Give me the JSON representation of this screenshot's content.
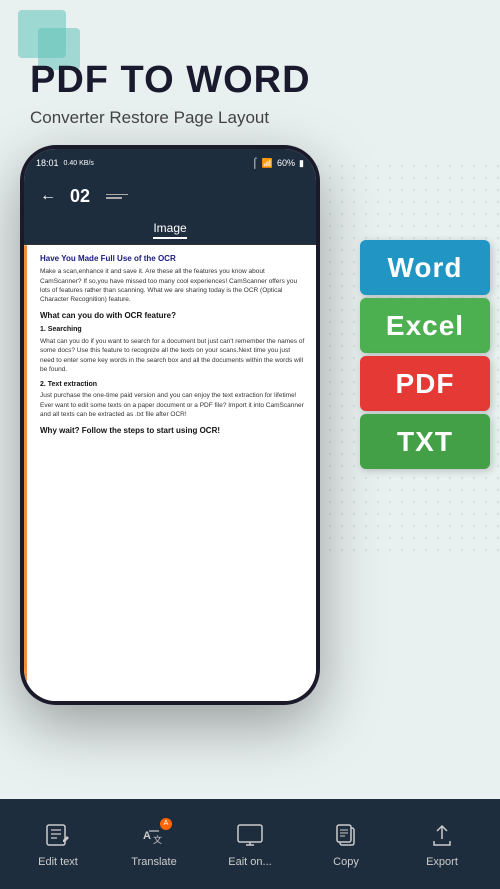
{
  "header": {
    "title": "PDF TO WORD",
    "subtitle": "Converter Restore Page Layout"
  },
  "status_bar": {
    "time": "18:01",
    "speed": "0.40 KB/s",
    "battery": "60%",
    "signal": "bluetooth wifi"
  },
  "phone_nav": {
    "back_icon": "←",
    "page_number": "02"
  },
  "phone_tab": {
    "label": "Image"
  },
  "document": {
    "heading": "Have You Made Full Use of the OCR",
    "body1": "Make a scan,enhance it and save it. Are these all the features you know about CamScanner? If so,you have missed too many cool experiences! CamScanner offers you lots of features rather than scanning. What we are sharing today is the OCR (Optical Character Recognition) feature.",
    "subheading1": "What can you do with OCR feature?",
    "numbered1": "1. Searching",
    "body2": "What can you do if you want to search for a document but just can't remember the names of some docs? Use this feature to recognize all the texts on your scans.Next time you just need to enter some key words in the search box and all the documents within the words will be found.",
    "numbered2": "2. Text extraction",
    "body3": "Just purchase the one-time paid version and you can enjoy the text extraction for lifetime! Ever want to edit some texts on a paper document or a PDF file? Import it into CamScanner and all texts can be extracted as .txt file after OCR!",
    "subheading2": "Why wait? Follow the steps to start using OCR!"
  },
  "format_buttons": [
    {
      "label": "Word",
      "type": "word"
    },
    {
      "label": "Excel",
      "type": "excel"
    },
    {
      "label": "PDF",
      "type": "pdf"
    },
    {
      "label": "TXT",
      "type": "txt"
    }
  ],
  "toolbar": {
    "items": [
      {
        "id": "edit-text",
        "label": "Edit text",
        "icon": "edit"
      },
      {
        "id": "translate",
        "label": "Translate",
        "icon": "translate",
        "badge": "A"
      },
      {
        "id": "edit-on",
        "label": "Eait on...",
        "icon": "monitor"
      },
      {
        "id": "copy",
        "label": "Copy",
        "icon": "copy"
      },
      {
        "id": "export",
        "label": "Export",
        "icon": "export"
      }
    ]
  }
}
